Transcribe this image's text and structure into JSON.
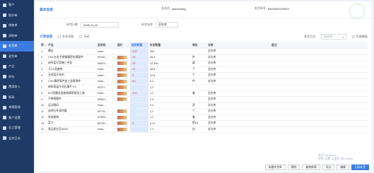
{
  "sidebar": {
    "items": [
      {
        "label": "客户"
      },
      {
        "label": "报价单"
      },
      {
        "label": "销售单"
      },
      {
        "label": "采购单"
      },
      {
        "label": "补货单"
      },
      {
        "label": "退货单"
      },
      {
        "label": "产品"
      },
      {
        "label": "库存"
      },
      {
        "label": "费用收入"
      },
      {
        "label": "报表"
      },
      {
        "label": "单据管理"
      },
      {
        "label": "客户设置"
      },
      {
        "label": "员工管理"
      },
      {
        "label": "业务日志"
      }
    ]
  },
  "header": {
    "title": "基本信息",
    "business_label": "业务员",
    "business_value": "miaozhang",
    "doc_label": "补货单号",
    "doc_value": "BH20251120003"
  },
  "form": {
    "date_label": "补货日期",
    "date_value": "2025-11-20",
    "warehouse_label": "补货仓库",
    "warehouse_value": "总仓库"
  },
  "toolbar": {
    "order_products": "订单信息",
    "bulk_add": "补货采购",
    "import": "扫码",
    "dropdown_label": "补货方式",
    "dropdown_value": "请选择",
    "price_label": "价格模板"
  },
  "table": {
    "columns": [
      "序号",
      "产品",
      "条形码",
      "图片",
      "缺货数量",
      "补货数量",
      "单位",
      "仓库",
      "备注"
    ],
    "rows": [
      {
        "no": "1",
        "product": "螺丝",
        "barcode": "miao...",
        "qty_out": "-465",
        "qty_add": "300",
        "unit": "",
        "wh": "总仓库",
        "thumb": false
      },
      {
        "no": "2",
        "product": "CNC五金不锈钢精密金属配件",
        "barcode": "69160...",
        "qty_out": "-28",
        "qty_add": "28.4",
        "unit": "件",
        "wh": "总仓库",
        "thumb": true
      },
      {
        "no": "3",
        "product": "迷你蓝牙音箱三合包",
        "barcode": "69093...",
        "qty_out": "-95",
        "qty_add": "22.33h",
        "unit": "盒",
        "wh": "总仓库",
        "thumb": true
      },
      {
        "no": "4",
        "product": "*打火机套装",
        "barcode": "miao...",
        "qty_out": "-15",
        "qty_add": "18.8",
        "unit": "个",
        "wh": "总仓库",
        "thumb": true
      },
      {
        "no": "5",
        "product": "无线蓝牙耳机",
        "barcode": "miao...",
        "qty_out": "-8",
        "qty_add": "12.8",
        "unit": "个",
        "wh": "总仓库",
        "thumb": true
      },
      {
        "no": "6",
        "product": "CNC精密零件加工金属零件",
        "barcode": "miao...",
        "qty_out": "-60",
        "qty_add": "0.2",
        "unit": "件",
        "wh": "总仓库",
        "thumb": true
      },
      {
        "no": "7",
        "product": "新款高温冷却石墨片*10",
        "barcode": "69707...",
        "qty_out": "",
        "qty_add": "1.2",
        "unit": "",
        "wh": "",
        "thumb": true
      },
      {
        "no": "8",
        "product": "523型螺丝批套装精密组合工具",
        "barcode": "miao...",
        "qty_out": "-100",
        "qty_add": "1.2",
        "unit": "套",
        "wh": "总仓库",
        "thumb": true
      },
      {
        "no": "9",
        "product": "不锈钢管件",
        "barcode": "69520...",
        "qty_out": "",
        "qty_add": "2.4",
        "unit": "",
        "wh": "总仓库",
        "thumb": true
      },
      {
        "no": "10",
        "product": "运动鞋码",
        "barcode": "miao...",
        "qty_out": "",
        "qty_add": "2.4",
        "unit": "双",
        "wh": "总仓库",
        "thumb": false
      },
      {
        "no": "11",
        "product": "迷你红外遥控器",
        "barcode": "69731...",
        "qty_out": "",
        "qty_add": "1.2",
        "unit": "个",
        "wh": "总仓库",
        "thumb": true
      },
      {
        "no": "12",
        "product": "茶具套装",
        "barcode": "67896...",
        "qty_out": "",
        "qty_add": "1.2",
        "unit": "套",
        "wh": "总仓库",
        "thumb": true
      },
      {
        "no": "13",
        "product": "菜刀",
        "barcode": "69700...",
        "qty_out": "-3",
        "qty_add": "0.12",
        "unit": "把(1)",
        "wh": "总仓库",
        "thumb": true
      },
      {
        "no": "14",
        "product": "高品质红豆200G",
        "barcode": "miao...",
        "qty_out": "",
        "qty_add": "1.2",
        "unit": "包",
        "wh": "总仓库",
        "thumb": true
      }
    ]
  },
  "footer": {
    "buttons": [
      "新建补货单",
      "删除",
      "复制新增",
      "导出",
      "编辑",
      "扫码补货"
    ]
  },
  "watermark": {
    "line1": "激活 Windows",
    "line2": "转到\"设置\"以激活 Windows。"
  }
}
